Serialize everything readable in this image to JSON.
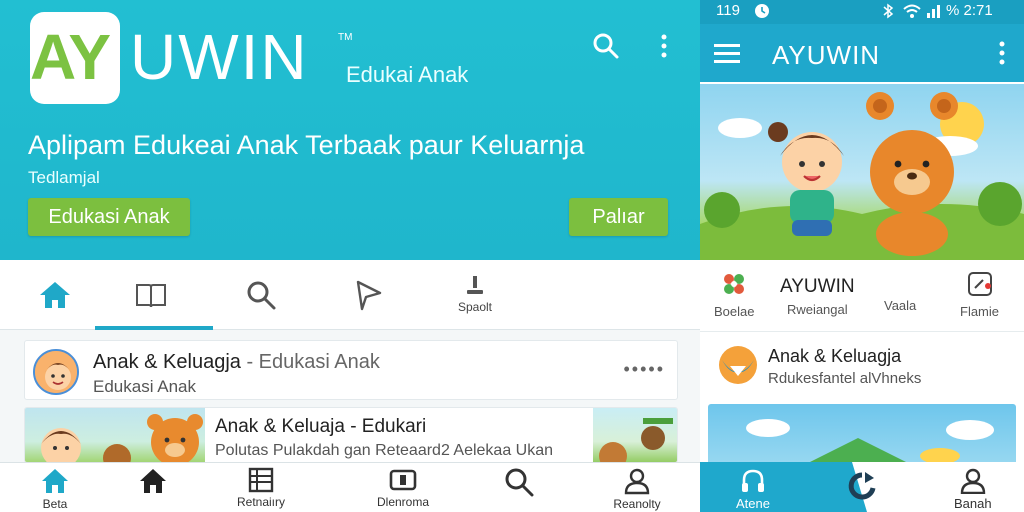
{
  "left": {
    "logo": {
      "ay": "AY",
      "uwin": "UWIN",
      "tm": "TM",
      "subtitle": "Edukai Anak"
    },
    "hero": {
      "title": "Aplipam Edukeai Anak Terbaak paur Keluarnja",
      "subtitle": "Tedlamjal",
      "primary_button": "Edukasi Anak",
      "secondary_button": "Palıar"
    },
    "tabs": [
      {
        "icon": "home-icon",
        "label": ""
      },
      {
        "icon": "book-icon",
        "label": ""
      },
      {
        "icon": "search-icon",
        "label": ""
      },
      {
        "icon": "paper-plane-icon",
        "label": ""
      },
      {
        "icon": "pin-icon",
        "label": "Spaolt"
      }
    ],
    "card1": {
      "title": "Anak & Keluagja",
      "title_suffix": " - Edukasi Anak",
      "subtitle": "Edukasi Anak",
      "more": "•••••"
    },
    "card2": {
      "title": "Anak & Keluaja - Edukari",
      "subtitle": "Polutas Pulakdah gan Reteaard2 Aelekaa Ukan"
    },
    "bottom_nav": [
      {
        "icon": "home-icon",
        "label": "Beta"
      },
      {
        "icon": "home-filled-icon",
        "label": ""
      },
      {
        "icon": "list-icon",
        "label": "Retnaiıry"
      },
      {
        "icon": "book-open-icon",
        "label": "Dlenroma"
      },
      {
        "icon": "search-icon",
        "label": ""
      },
      {
        "icon": "user-icon",
        "label": "Reanolty"
      }
    ]
  },
  "right": {
    "status": {
      "left": "119",
      "right": "% 2:71"
    },
    "appbar_title": "AYUWIN",
    "quick": [
      {
        "icon": "flower-icon",
        "label": "Boelae"
      },
      {
        "icon": "",
        "label": "Rweiangal",
        "title": "AYUWIN"
      },
      {
        "icon": "",
        "label": "Vaala"
      },
      {
        "icon": "edit-icon",
        "label": "Flamie"
      }
    ],
    "card": {
      "title": "Anak & Keluagja",
      "subtitle": "Rdukesfantel alVhneks"
    },
    "nav": [
      {
        "icon": "headphones-icon",
        "label": "Atene"
      },
      {
        "icon": "refresh-icon",
        "label": ""
      },
      {
        "icon": "user-icon",
        "label": "Banah"
      }
    ]
  },
  "colors": {
    "primary": "#1fb6cc",
    "accent_green": "#7cbf3f",
    "active_tab": "#1fa8c8"
  }
}
